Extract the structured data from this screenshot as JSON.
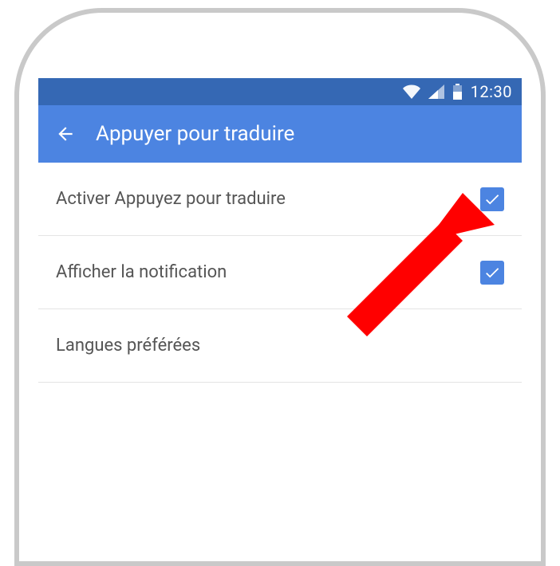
{
  "status_bar": {
    "time": "12:30",
    "icons": {
      "wifi": "wifi-icon",
      "signal": "signal-icon",
      "battery": "battery-icon"
    }
  },
  "app_bar": {
    "title": "Appuyer pour traduire"
  },
  "settings": [
    {
      "label": "Activer Appuyez pour traduire",
      "checked": true
    },
    {
      "label": "Afficher la notification",
      "checked": true
    },
    {
      "label": "Langues préférées",
      "checked": null
    }
  ],
  "annotation": {
    "color": "#ff0000"
  }
}
